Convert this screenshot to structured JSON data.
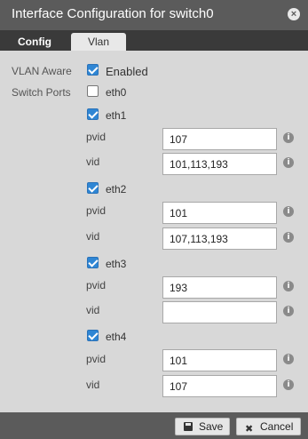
{
  "window": {
    "title": "Interface Configuration for switch0",
    "close_icon": "×"
  },
  "tabs": [
    {
      "label": "Config",
      "active": false
    },
    {
      "label": "Vlan",
      "active": true
    }
  ],
  "vlan_aware": {
    "label": "VLAN Aware",
    "checkbox_label": "Enabled",
    "checked": true
  },
  "switch_ports": {
    "label": "Switch Ports",
    "ports": [
      {
        "name": "eth0",
        "checked": false
      },
      {
        "name": "eth1",
        "checked": true,
        "pvid_label": "pvid",
        "pvid": "107",
        "vid_label": "vid",
        "vid": "101,113,193"
      },
      {
        "name": "eth2",
        "checked": true,
        "pvid_label": "pvid",
        "pvid": "101",
        "vid_label": "vid",
        "vid": "107,113,193"
      },
      {
        "name": "eth3",
        "checked": true,
        "pvid_label": "pvid",
        "pvid": "193",
        "vid_label": "vid",
        "vid": ""
      },
      {
        "name": "eth4",
        "checked": true,
        "pvid_label": "pvid",
        "pvid": "101",
        "vid_label": "vid",
        "vid": "107"
      }
    ]
  },
  "info_icon": "i",
  "footer": {
    "save_label": "Save",
    "cancel_label": "Cancel",
    "cancel_icon": "✖"
  }
}
